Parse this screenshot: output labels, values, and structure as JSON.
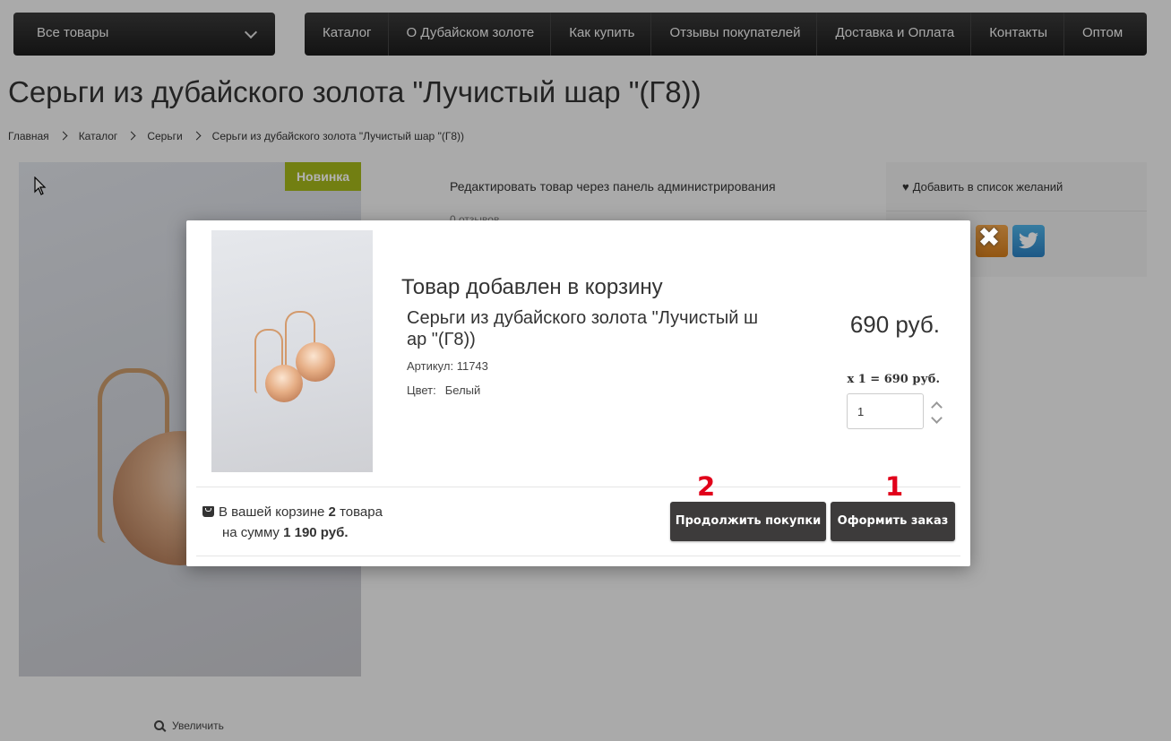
{
  "header": {
    "all_products": "Все товары",
    "nav": [
      "Каталог",
      "О Дубайском золоте",
      "Как купить",
      "Отзывы покупателей",
      "Доставка и Оплата",
      "Контакты",
      "Оптом"
    ]
  },
  "page": {
    "title": "Серьги из дубайского золота \"Лучистый шар \"(Г8))",
    "breadcrumbs": [
      "Главная",
      "Каталог",
      "Серьги",
      "Серьги из дубайского золота \"Лучистый шар \"(Г8))"
    ],
    "badge": "Новинка",
    "zoom_label": "Увеличить",
    "admin_link": "Редактировать товар через панель администрирования",
    "reviews": "0 отзывов",
    "wishlist": "Добавить в список желаний"
  },
  "modal": {
    "close_symbol": "✖",
    "heading": "Товар добавлен в корзину",
    "product_name": "Серьги из дубайского золота \"Лучистый шар \"(Г8))",
    "sku_label": "Артикул:",
    "sku": "11743",
    "color_label": "Цвет:",
    "color": "Белый",
    "price": "690 руб.",
    "line_total": "x 1 = 690 руб.",
    "quantity": "1",
    "cart_text_1": "В вашей корзине",
    "cart_count": "2",
    "cart_text_2": "товара",
    "cart_text_3": "на сумму",
    "cart_sum": "1 190 руб.",
    "continue_button": "Продолжить покупки",
    "checkout_button": "Оформить заказ",
    "annotation_continue": "2",
    "annotation_checkout": "1"
  },
  "icons": {
    "dropdown": "chevron-down-icon",
    "breadcrumb_separator": "chevron-right-icon",
    "zoom": "search-icon",
    "wishlist": "heart-icon",
    "social_1": "odnoklassniki-icon",
    "social_2": "twitter-icon",
    "cart": "shopping-bag-icon",
    "spinner": "chevron-up-down-icon"
  },
  "colors": {
    "nav_bg": "#2a2a2a",
    "badge_bg": "#a4b61a",
    "button_bg": "#3d3b3b",
    "annotation_red": "#e1001a"
  }
}
